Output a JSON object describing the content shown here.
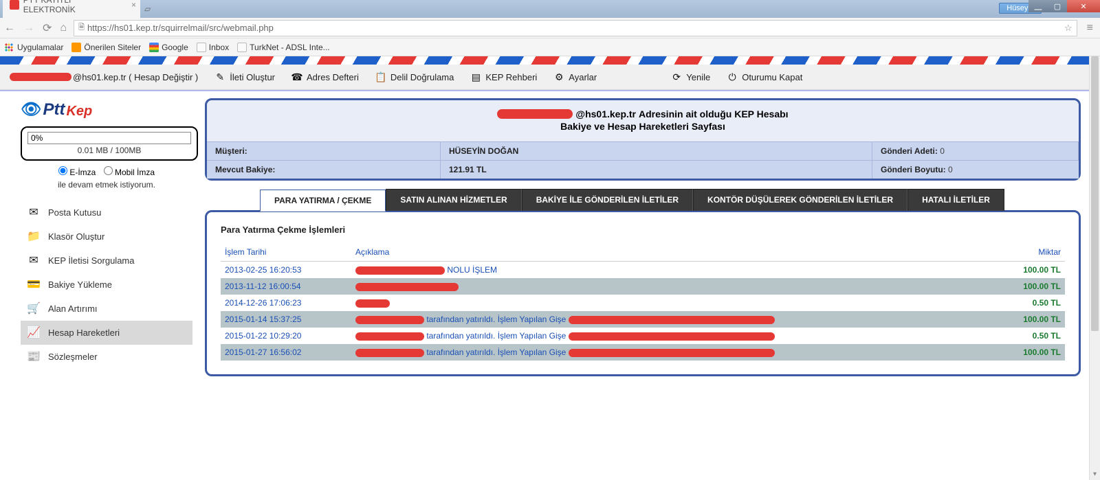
{
  "window": {
    "user": "Hüseyin",
    "min": "⎽",
    "max": "▢",
    "close": "✕"
  },
  "browser": {
    "tab_title": "PTT KAYITLI ELEKTRONİK",
    "url": "https://hs01.kep.tr/squirrelmail/src/webmail.php",
    "apps": "Uygulamalar",
    "bookmarks": [
      "Önerilen Siteler",
      "Google",
      "Inbox",
      "TurkNet - ADSL Inte..."
    ]
  },
  "topbar": {
    "account_suffix": "@hs01.kep.tr ( Hesap Değiştir )",
    "compose": "İleti Oluştur",
    "address": "Adres Defteri",
    "verify": "Delil Doğrulama",
    "guide": "KEP Rehberi",
    "settings": "Ayarlar",
    "refresh": "Yenile",
    "logout": "Oturumu Kapat"
  },
  "sidebar": {
    "quota_pct": "0%",
    "quota_text": "0.01 MB / 100MB",
    "radio_eimza": "E-İmza",
    "radio_mobil": "Mobil İmza",
    "radio_sub": "ile devam etmek istiyorum.",
    "items": [
      {
        "icon": "✉",
        "label": "Posta Kutusu"
      },
      {
        "icon": "📁",
        "label": "Klasör Oluştur"
      },
      {
        "icon": "✉",
        "label": "KEP İletisi Sorgulama"
      },
      {
        "icon": "💳",
        "label": "Bakiye Yükleme"
      },
      {
        "icon": "🛒",
        "label": "Alan Artırımı"
      },
      {
        "icon": "📈",
        "label": "Hesap Hareketleri"
      },
      {
        "icon": "📰",
        "label": "Sözleşmeler"
      }
    ],
    "active_index": 5
  },
  "panel": {
    "head_suffix": "@hs01.kep.tr",
    "head_after": " Adresinin ait olduğu KEP Hesabı",
    "head_line2": "Bakiye ve Hesap Hareketleri Sayfası",
    "musteri_label": "Müşteri:",
    "musteri_value": "HÜSEYİN DOĞAN",
    "bakiye_label": "Mevcut Bakiye:",
    "bakiye_value": "121.91 TL",
    "gonderi_adeti_label": "Gönderi Adeti:",
    "gonderi_adeti_value": "0",
    "gonderi_boyutu_label": "Gönderi Boyutu:",
    "gonderi_boyutu_value": "0"
  },
  "tabs": {
    "t0": "PARA YATIRMA / ÇEKME",
    "t1": "SATIN ALINAN HİZMETLER",
    "t2": "BAKİYE İLE GÖNDERİLEN İLETİLER",
    "t3": "KONTÖR DÜŞÜLEREK GÖNDERİLEN İLETİLER",
    "t4": "HATALI İLETİLER"
  },
  "txn": {
    "title": "Para Yatırma Çekme İşlemleri",
    "col_date": "İşlem Tarihi",
    "col_desc": "Açıklama",
    "col_amount": "Miktar",
    "rows": [
      {
        "date": "2013-02-25 16:20:53",
        "desc_suffix": " NOLU İŞLEM",
        "red1": 130,
        "red2": 0,
        "red3": 0,
        "amount": "100.00 TL"
      },
      {
        "date": "2013-11-12 16:00:54",
        "desc_suffix": "",
        "red1": 150,
        "red2": 0,
        "red3": 0,
        "amount": "100.00 TL"
      },
      {
        "date": "2014-12-26 17:06:23",
        "desc_suffix": "",
        "red1": 50,
        "red2": 0,
        "red3": 0,
        "amount": "0.50 TL"
      },
      {
        "date": "2015-01-14 15:37:25",
        "desc_suffix": " tarafından yatırıldı. İşlem Yapılan Gişe ",
        "red1": 100,
        "red2": 300,
        "red3": 0,
        "amount": "100.00 TL"
      },
      {
        "date": "2015-01-22 10:29:20",
        "desc_suffix": " tarafından yatırıldı. İşlem Yapılan Gişe ",
        "red1": 100,
        "red2": 300,
        "red3": 0,
        "amount": "0.50 TL"
      },
      {
        "date": "2015-01-27 16:56:02",
        "desc_suffix": " tarafından yatırıldı. İşlem Yapılan Gişe ",
        "red1": 100,
        "red2": 300,
        "red3": 0,
        "amount": "100.00 TL"
      }
    ]
  },
  "logo": {
    "ptt": "Ptt",
    "kep": "Kep"
  }
}
